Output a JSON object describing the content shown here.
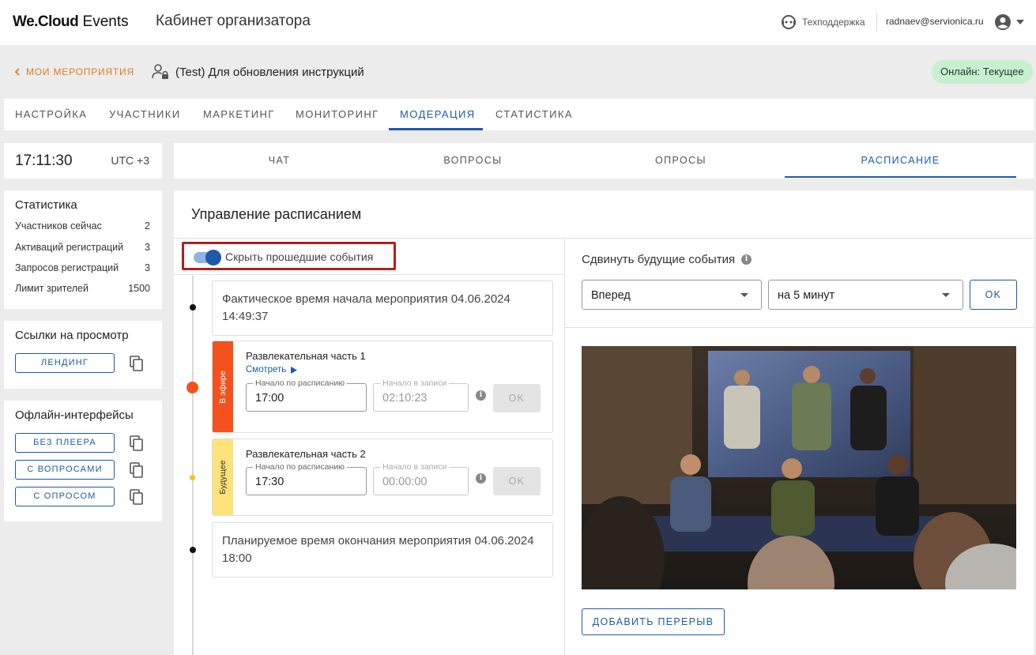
{
  "header": {
    "logo_bold": "We.Cloud",
    "logo_rest": "Events",
    "cabinet_title": "Кабинет организатора",
    "support_label": "Техподдержка",
    "user_email": "radnaev@servionica.ru"
  },
  "event_bar": {
    "back_label": "МОИ МЕРОПРИЯТИЯ",
    "event_title": "(Test) Для обновления инструкций",
    "status_badge": "Онлайн: Текущее"
  },
  "main_tabs": [
    {
      "label": "Настройка"
    },
    {
      "label": "Участники"
    },
    {
      "label": "Маркетинг"
    },
    {
      "label": "Мониторинг"
    },
    {
      "label": "Модерация",
      "active": true
    },
    {
      "label": "Статистика"
    }
  ],
  "clock": {
    "time": "17:11:30",
    "timezone": "UTC +3"
  },
  "stats": {
    "title": "Статистика",
    "rows": [
      {
        "label": "Участников сейчас",
        "value": "2"
      },
      {
        "label": "Активаций регистраций",
        "value": "3"
      },
      {
        "label": "Запросов регистраций",
        "value": "3"
      },
      {
        "label": "Лимит зрителей",
        "value": "1500"
      }
    ]
  },
  "view_links": {
    "title": "Ссылки на просмотр",
    "buttons": [
      {
        "label": "Лендинг"
      }
    ]
  },
  "offline": {
    "title": "Офлайн-интерфейсы",
    "buttons": [
      {
        "label": "Без плеера"
      },
      {
        "label": "С вопросами"
      },
      {
        "label": "С опросом"
      }
    ]
  },
  "sub_tabs": [
    {
      "label": "Чат"
    },
    {
      "label": "Вопросы"
    },
    {
      "label": "Опросы"
    },
    {
      "label": "Расписание",
      "active": true
    }
  ],
  "schedule": {
    "heading": "Управление расписанием",
    "hide_past_label": "Скрыть прошедшие события",
    "hide_past_enabled": true,
    "actual_start": "Фактическое время начала мероприятия 04.06.2024 14:49:37",
    "segments": [
      {
        "status": "В эфире",
        "status_color": "#f4511e",
        "title": "Развлекательная часть 1",
        "watch_label": "Смотреть",
        "scheduled_label": "Начало по расписанию",
        "scheduled_value": "17:00",
        "record_label": "Начало в записи",
        "record_value": "02:10:23",
        "ok_label": "OK"
      },
      {
        "status": "Будущее",
        "status_color": "#ffe27a",
        "title": "Развлекательная часть 2",
        "scheduled_label": "Начало по расписанию",
        "scheduled_value": "17:30",
        "record_label": "Начало в записи",
        "record_value": "00:00:00",
        "ok_label": "OK"
      }
    ],
    "planned_end": "Планируемое время окончания мероприятия 04.06.2024 18:00",
    "shift": {
      "label": "Сдвинуть будущие события",
      "direction": "Вперед",
      "amount": "на 5 минут",
      "ok_label": "OK"
    },
    "add_break_label": "Добавить перерыв"
  },
  "colors": {
    "accent": "#1e5aa8",
    "back_link": "#e07a1e",
    "live": "#f4511e",
    "future": "#ffe27a",
    "badge_bg": "#c9efd1",
    "highlight": "#b0201c"
  }
}
